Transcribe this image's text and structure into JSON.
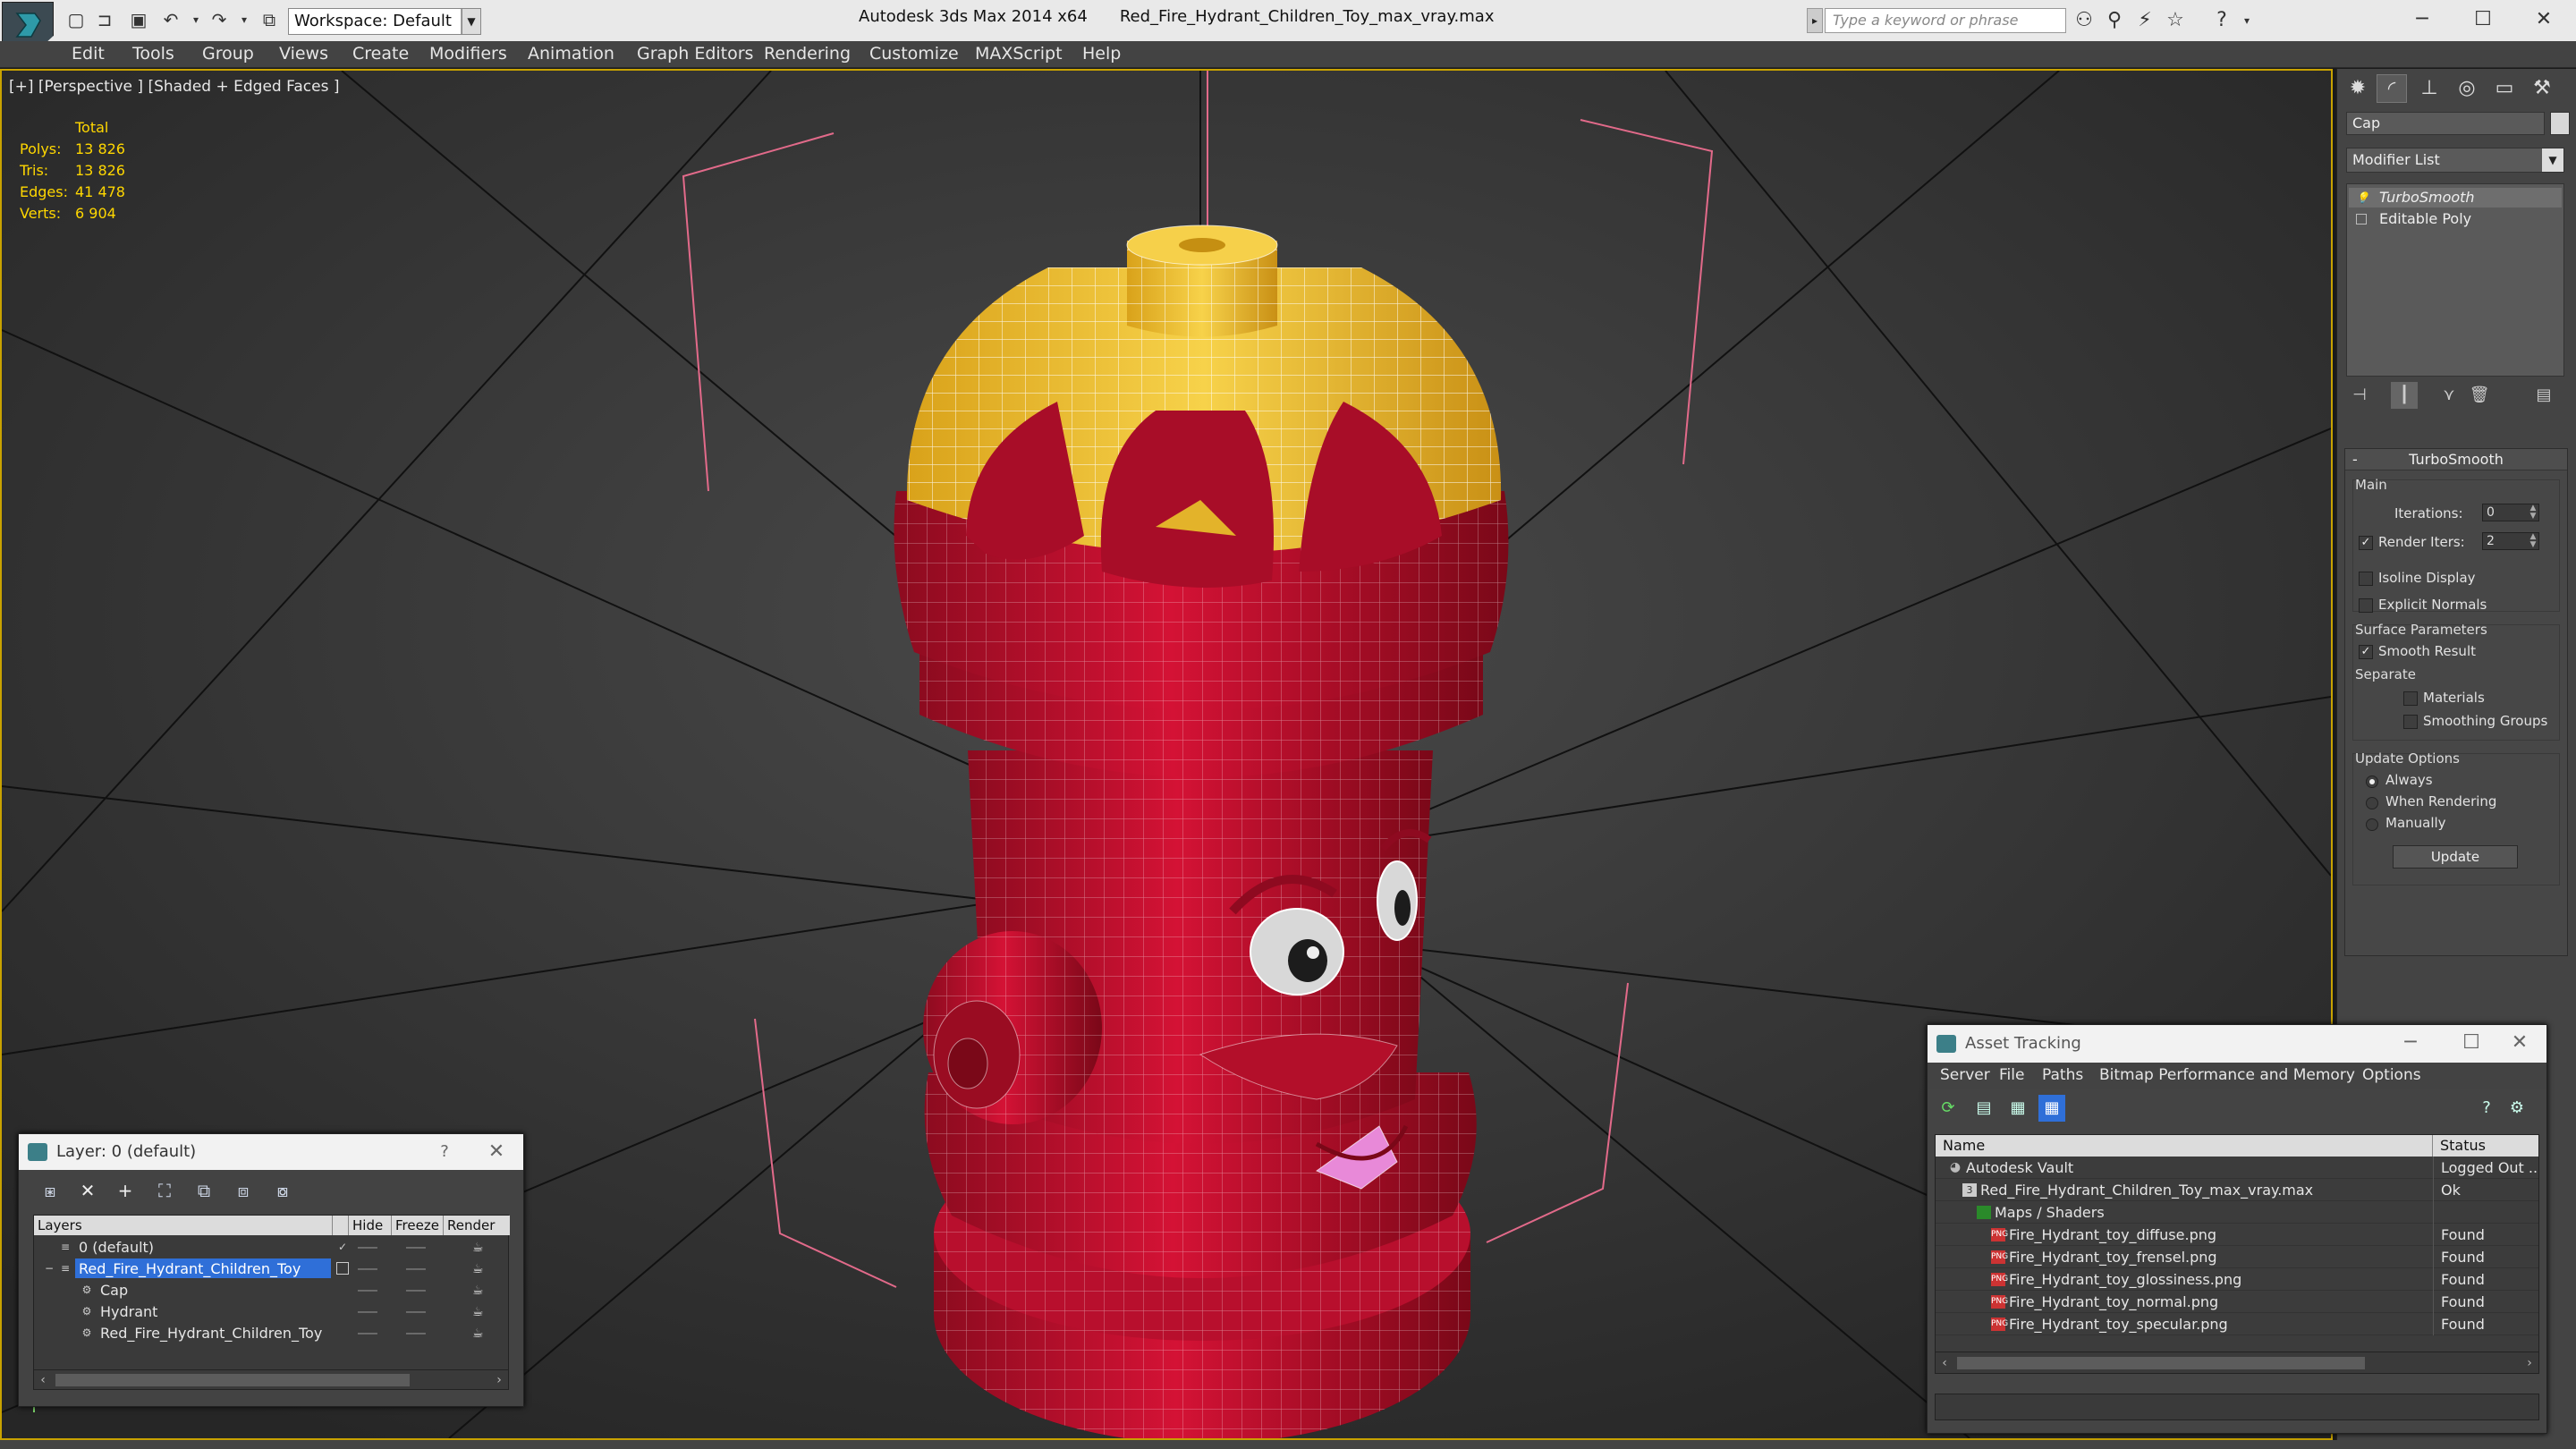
{
  "titlebar": {
    "workspace": "Workspace: Default",
    "app": "Autodesk 3ds Max  2014 x64",
    "file": "Red_Fire_Hydrant_Children_Toy_max_vray.max",
    "search_placeholder": "Type a keyword or phrase"
  },
  "menu": [
    "Edit",
    "Tools",
    "Group",
    "Views",
    "Create",
    "Modifiers",
    "Animation",
    "Graph Editors",
    "Rendering",
    "Customize",
    "MAXScript",
    "Help"
  ],
  "viewport": {
    "label": "[+] [Perspective ] [Shaded + Edged Faces ]",
    "stats": {
      "header": "Total",
      "rows": [
        {
          "k": "Polys:",
          "v": "13 826"
        },
        {
          "k": "Tris:",
          "v": "13 826"
        },
        {
          "k": "Edges:",
          "v": "41 478"
        },
        {
          "k": "Verts:",
          "v": "6 904"
        }
      ]
    }
  },
  "command_panel": {
    "object_name": "Cap",
    "modifier_list": "Modifier List",
    "stack": [
      "TurboSmooth",
      "Editable Poly"
    ],
    "turbosmooth": {
      "title": "TurboSmooth",
      "main": "Main",
      "iterations_label": "Iterations:",
      "iterations": "0",
      "render_iters_label": "Render Iters:",
      "render_iters": "2",
      "isoline": "Isoline Display",
      "explicit": "Explicit Normals",
      "surface_params": "Surface Parameters",
      "smooth_result": "Smooth Result",
      "separate": "Separate",
      "materials": "Materials",
      "smoothing_groups": "Smoothing Groups",
      "update_options": "Update Options",
      "always": "Always",
      "when_rendering": "When Rendering",
      "manually": "Manually",
      "update": "Update"
    }
  },
  "layer_dialog": {
    "title": "Layer: 0 (default)",
    "cols": [
      "Layers",
      "Hide",
      "Freeze",
      "Render"
    ],
    "rows": [
      "0 (default)",
      "Red_Fire_Hydrant_Children_Toy",
      "Cap",
      "Hydrant",
      "Red_Fire_Hydrant_Children_Toy"
    ]
  },
  "asset_dialog": {
    "title": "Asset Tracking",
    "menu": [
      "Server",
      "File",
      "Paths",
      "Bitmap Performance and Memory",
      "Options"
    ],
    "cols": [
      "Name",
      "Status"
    ],
    "rows": [
      {
        "name": "Autodesk Vault",
        "status": "Logged Out ..."
      },
      {
        "name": "Red_Fire_Hydrant_Children_Toy_max_vray.max",
        "status": "Ok"
      },
      {
        "name": "Maps / Shaders",
        "status": ""
      },
      {
        "name": "Fire_Hydrant_toy_diffuse.png",
        "status": "Found"
      },
      {
        "name": "Fire_Hydrant_toy_frensel.png",
        "status": "Found"
      },
      {
        "name": "Fire_Hydrant_toy_glossiness.png",
        "status": "Found"
      },
      {
        "name": "Fire_Hydrant_toy_normal.png",
        "status": "Found"
      },
      {
        "name": "Fire_Hydrant_toy_specular.png",
        "status": "Found"
      }
    ]
  },
  "colors": {
    "accent": "#2f6fd8",
    "hydrant_red": "#c8102e",
    "cap_yellow": "#f2c12e",
    "stats_yellow": "#ffd700"
  }
}
